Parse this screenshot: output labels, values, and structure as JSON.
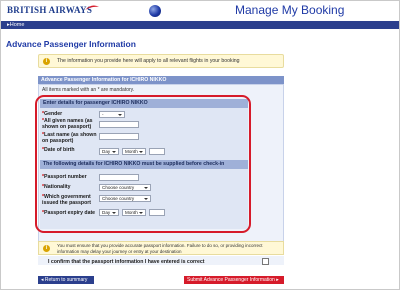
{
  "header": {
    "brand": "BRITISH AIRWAYS",
    "title": "Manage My Booking"
  },
  "nav": {
    "home": "▸Home"
  },
  "page": {
    "section_title": "Advance Passenger Information",
    "info_message": "The information you provide here will apply to all relevant flights in your booking"
  },
  "panel": {
    "header": "Advance Passenger Information for ICHIRO NIKKO",
    "mandatory_note": "All items marked with an * are mandatory."
  },
  "passenger_details": {
    "header": "Enter details for passenger ICHIRO NIKKO",
    "fields": [
      {
        "label": "Gender",
        "value": "-"
      },
      {
        "label": "All given names (as shown on passport)",
        "value": ""
      },
      {
        "label": "Last name (as shown on passport)",
        "value": ""
      },
      {
        "label": "Date of birth",
        "day": "Day",
        "month": "Month",
        "year": ""
      }
    ]
  },
  "passport_details": {
    "header": "The following details for ICHIRO NIKKO must be supplied before check-in",
    "fields": [
      {
        "label": "Passport number",
        "value": ""
      },
      {
        "label": "Nationality",
        "value": "Choose country"
      },
      {
        "label": "Which government issued the passport",
        "value": "Choose country"
      },
      {
        "label": "Passport expiry date",
        "day": "Day",
        "month": "Month",
        "year": ""
      }
    ]
  },
  "notice": {
    "text": "You must ensure that you provide accurate passport information. Failure to do so, or providing incorrect information may delay your journey or entry at your destination",
    "confirm_label": "I confirm that the passport information I have entered is correct"
  },
  "buttons": {
    "back": "◂ Return to summary",
    "submit": "Submit Advance Passenger Information ▸"
  }
}
